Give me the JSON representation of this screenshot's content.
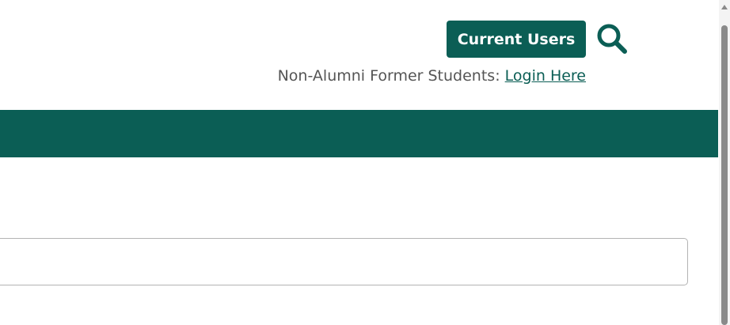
{
  "header": {
    "current_users_label": "Current Users",
    "search_icon": "search-icon",
    "former_students_text": "Non-Alumni Former Students: ",
    "login_link_label": "Login Here"
  },
  "colors": {
    "brand_green": "#0b5e55",
    "text_gray": "#555555",
    "border_gray": "#b3b3b3"
  }
}
